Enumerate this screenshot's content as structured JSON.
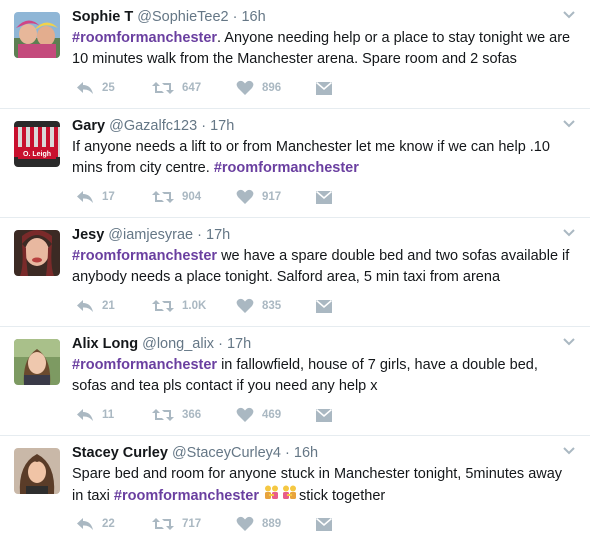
{
  "tweets": [
    {
      "name": "Sophie T",
      "handle": "@SophieTee2",
      "time": "16h",
      "hashtag_first": "#roomformanchester",
      "text_after": ". Anyone needing help or a place to stay tonight we are 10 minutes walk from the Manchester arena. Spare room and 2 sofas",
      "replies": "25",
      "retweets": "647",
      "likes": "896"
    },
    {
      "name": "Gary",
      "handle": "@Gazalfc123",
      "time": "17h",
      "text_before": "If anyone needs a lift to or from Manchester let me know if we can help .10 mins from city centre. ",
      "hashtag_last": "#roomformanchester",
      "replies": "17",
      "retweets": "904",
      "likes": "917",
      "avatar_text": "O. Leigh"
    },
    {
      "name": "Jesy",
      "handle": "@iamjesyrae",
      "time": "17h",
      "hashtag_first": "#roomformanchester",
      "text_after": " we have a spare double bed and two sofas available if anybody needs a place tonight. Salford area, 5 min taxi from arena",
      "replies": "21",
      "retweets": "1.0K",
      "likes": "835"
    },
    {
      "name": "Alix Long",
      "handle": "@long_alix",
      "time": "17h",
      "hashtag_first": "#roomformanchester",
      "text_after": " in fallowfield, house of 7 girls, have a double bed, sofas and tea pls contact if you need any help x",
      "replies": "11",
      "retweets": "366",
      "likes": "469"
    },
    {
      "name": "Stacey Curley",
      "handle": "@StaceyCurley4",
      "time": "16h",
      "text_before": "Spare bed and room for anyone stuck in Manchester tonight, 5minutes away in taxi ",
      "hashtag_mid": "#roomformanchester",
      "text_after": "stick together",
      "replies": "22",
      "retweets": "717",
      "likes": "889"
    }
  ],
  "separator": "·",
  "colors": {
    "hashtag": "#6a3fa0",
    "action_icon": "#aab8c2",
    "divider": "#e6ecf0",
    "meta": "#657786"
  },
  "icons": [
    "reply-icon",
    "retweet-icon",
    "like-icon",
    "direct-message-icon",
    "chevron-down-icon",
    "people-holding-hands-emoji"
  ]
}
